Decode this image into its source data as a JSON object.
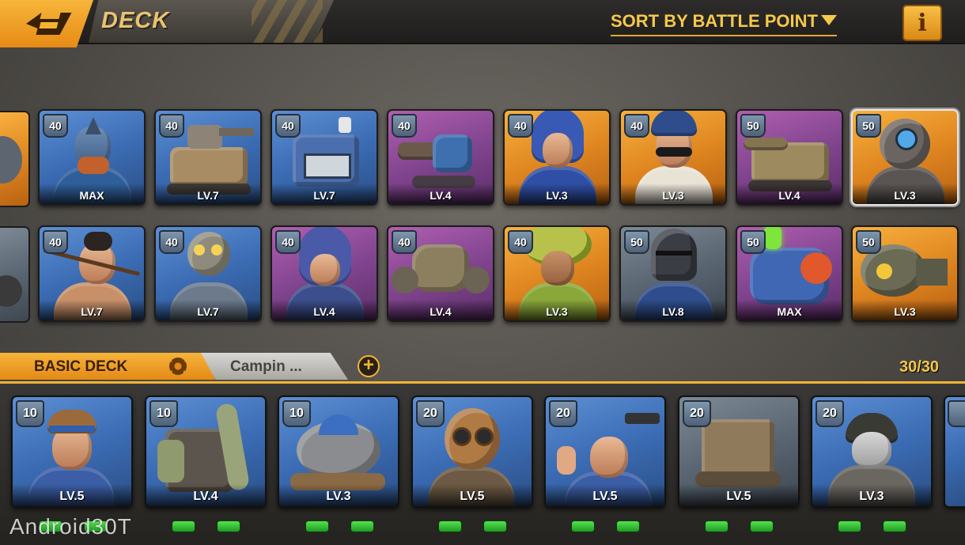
{
  "header": {
    "title": "DECK",
    "sort_label": "SORT BY BATTLE POINT",
    "info_label": "i",
    "back_icon": "back-arrow-icon"
  },
  "colors": {
    "accent": "#f2b431",
    "rarity_blue": "#3b6cb4",
    "rarity_purple": "#824590",
    "rarity_orange": "#e08721",
    "rarity_gray": "#5a6672"
  },
  "collection": {
    "row1": [
      {
        "cost": "40",
        "level": "MAX"
      },
      {
        "cost": "40",
        "level": "LV.7"
      },
      {
        "cost": "40",
        "level": "LV.7"
      },
      {
        "cost": "40",
        "level": "LV.4"
      },
      {
        "cost": "40",
        "level": "LV.3"
      },
      {
        "cost": "40",
        "level": "LV.3"
      },
      {
        "cost": "50",
        "level": "LV.4"
      },
      {
        "cost": "50",
        "level": "LV.3"
      }
    ],
    "row2": [
      {
        "cost": "40",
        "level": "LV.7"
      },
      {
        "cost": "40",
        "level": "LV.7"
      },
      {
        "cost": "40",
        "level": "LV.4"
      },
      {
        "cost": "40",
        "level": "LV.4"
      },
      {
        "cost": "40",
        "level": "LV.3"
      },
      {
        "cost": "50",
        "level": "LV.8"
      },
      {
        "cost": "50",
        "level": "MAX"
      },
      {
        "cost": "50",
        "level": "LV.3"
      }
    ]
  },
  "deck_tabs": {
    "active": "BASIC DECK",
    "second": "Campin ...",
    "add_label": "+",
    "count": "30/30"
  },
  "deck": [
    {
      "cost": "10",
      "level": "LV.5"
    },
    {
      "cost": "10",
      "level": "LV.4"
    },
    {
      "cost": "10",
      "level": "LV.3"
    },
    {
      "cost": "20",
      "level": "LV.5"
    },
    {
      "cost": "20",
      "level": "LV.5"
    },
    {
      "cost": "20",
      "level": "LV.5"
    },
    {
      "cost": "20",
      "level": "LV.3"
    }
  ],
  "watermark": "Android30T"
}
